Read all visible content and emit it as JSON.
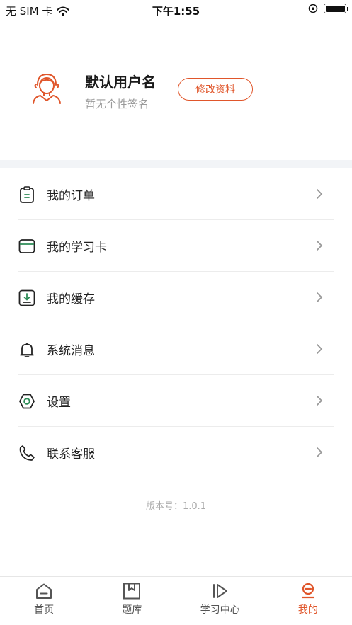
{
  "status_bar": {
    "carrier": "无 SIM 卡",
    "time": "下午1:55"
  },
  "profile": {
    "username": "默认用户名",
    "signature": "暂无个性签名",
    "edit_label": "修改资料"
  },
  "menu": [
    {
      "label": "我的订单",
      "icon": "order-clipboard-icon"
    },
    {
      "label": "我的学习卡",
      "icon": "study-card-icon"
    },
    {
      "label": "我的缓存",
      "icon": "download-cache-icon"
    },
    {
      "label": "系统消息",
      "icon": "bell-icon"
    },
    {
      "label": "设置",
      "icon": "settings-hexagon-icon"
    },
    {
      "label": "联系客服",
      "icon": "phone-icon"
    }
  ],
  "version": "版本号：1.0.1",
  "tabs": [
    {
      "label": "首页",
      "icon": "home-icon",
      "active": false
    },
    {
      "label": "题库",
      "icon": "bookmark-box-icon",
      "active": false
    },
    {
      "label": "学习中心",
      "icon": "play-icon",
      "active": false
    },
    {
      "label": "我的",
      "icon": "profile-icon",
      "active": true
    }
  ],
  "colors": {
    "accent": "#e0562b",
    "icon_green": "#2e8b57",
    "text": "#222222",
    "muted": "#9a9a9a"
  }
}
